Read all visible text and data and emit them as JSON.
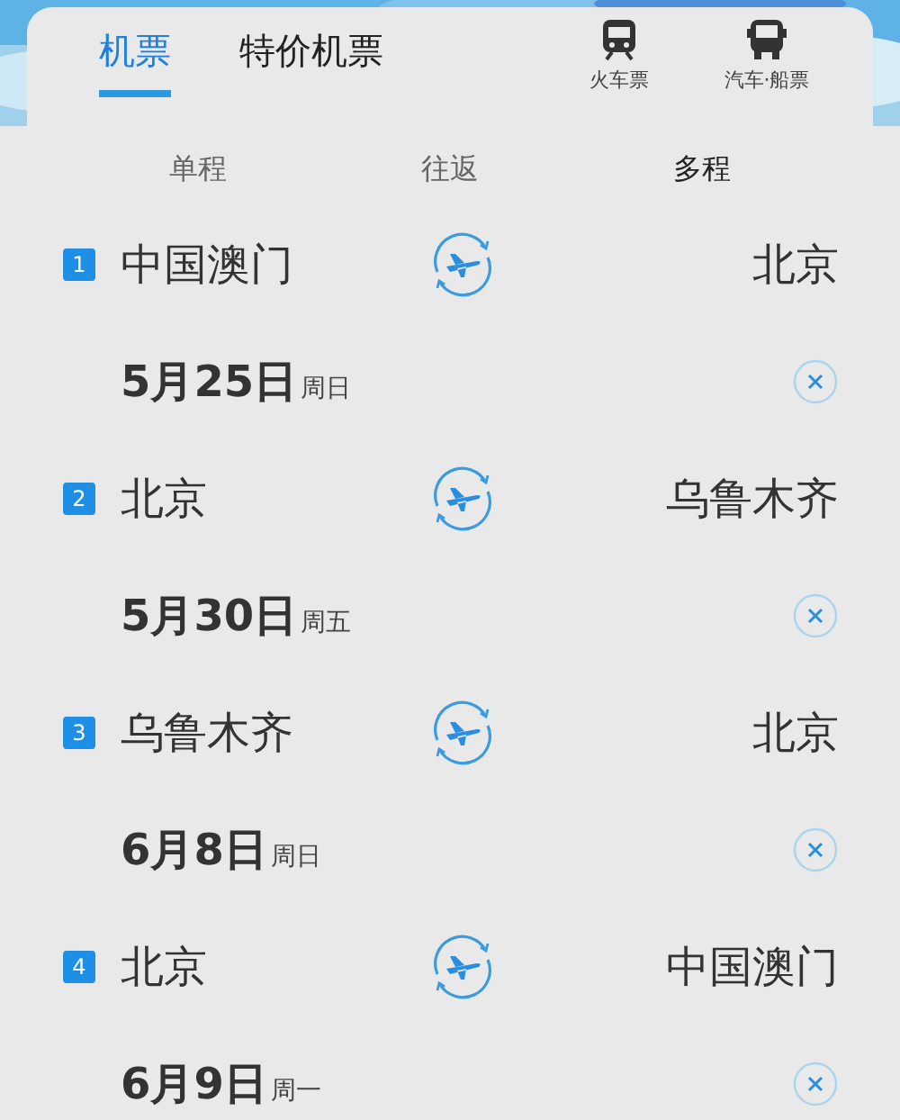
{
  "tabs": [
    {
      "label": "机票",
      "selected": true
    },
    {
      "label": "特价机票",
      "selected": false
    }
  ],
  "transport": [
    {
      "label": "火车票",
      "kind": "train"
    },
    {
      "label": "汽车·船票",
      "kind": "bus"
    }
  ],
  "trip_types": [
    {
      "label": "单程",
      "selected": false
    },
    {
      "label": "往返",
      "selected": false
    },
    {
      "label": "多程",
      "selected": true
    }
  ],
  "segments": [
    {
      "index": "1",
      "from": "中国澳门",
      "to": "北京",
      "date": "5月25日",
      "weekday": "周日"
    },
    {
      "index": "2",
      "from": "北京",
      "to": "乌鲁木齐",
      "date": "5月30日",
      "weekday": "周五"
    },
    {
      "index": "3",
      "from": "乌鲁木齐",
      "to": "北京",
      "date": "6月8日",
      "weekday": "周日"
    },
    {
      "index": "4",
      "from": "北京",
      "to": "中国澳门",
      "date": "6月9日",
      "weekday": "周一"
    }
  ]
}
